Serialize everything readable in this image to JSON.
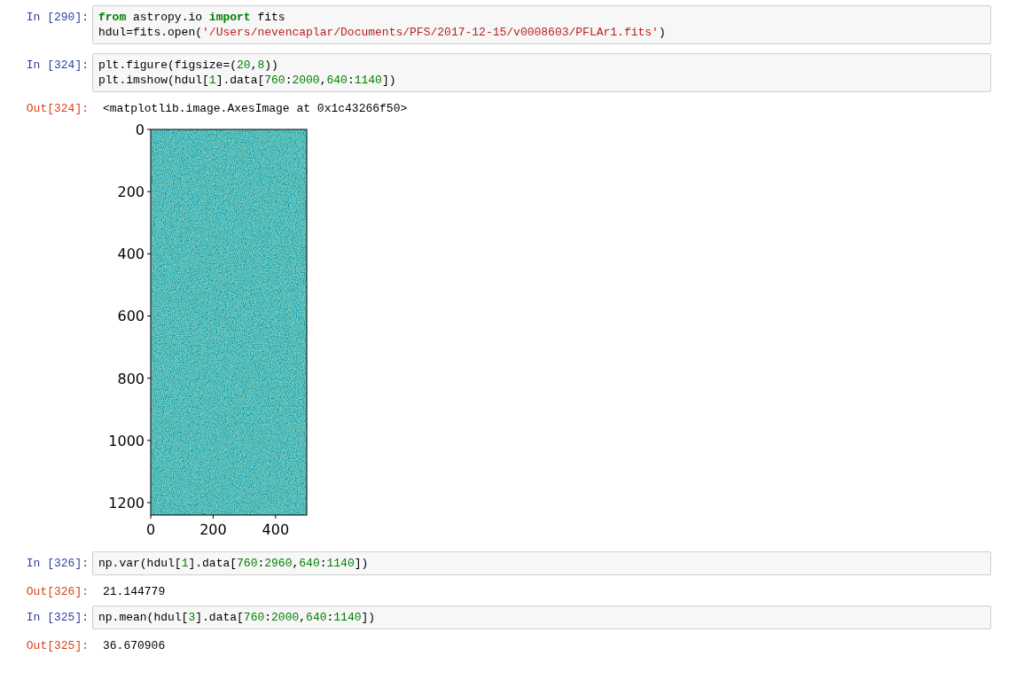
{
  "cells": [
    {
      "kind": "input",
      "prompt": "In [290]:",
      "lines": [
        [
          {
            "t": "from",
            "kind": "kw"
          },
          {
            "t": " astropy.io ",
            "kind": "plain"
          },
          {
            "t": "import",
            "kind": "kw"
          },
          {
            "t": " fits",
            "kind": "plain"
          }
        ],
        [
          {
            "t": "hdul=fits.open(",
            "kind": "plain"
          },
          {
            "t": "'/Users/nevencaplar/Documents/PFS/2017-12-15/v0008603/PFLAr1.fits'",
            "kind": "str"
          },
          {
            "t": ")",
            "kind": "plain"
          }
        ]
      ]
    },
    {
      "kind": "input",
      "prompt": "In [324]:",
      "lines": [
        [
          {
            "t": "plt.figure(figsize=(",
            "kind": "plain"
          },
          {
            "t": "20",
            "kind": "num"
          },
          {
            "t": ",",
            "kind": "plain"
          },
          {
            "t": "8",
            "kind": "num"
          },
          {
            "t": "))",
            "kind": "plain"
          }
        ],
        [
          {
            "t": "plt.imshow(hdul[",
            "kind": "plain"
          },
          {
            "t": "1",
            "kind": "num"
          },
          {
            "t": "].data[",
            "kind": "plain"
          },
          {
            "t": "760",
            "kind": "num"
          },
          {
            "t": ":",
            "kind": "plain"
          },
          {
            "t": "2000",
            "kind": "num"
          },
          {
            "t": ",",
            "kind": "plain"
          },
          {
            "t": "640",
            "kind": "num"
          },
          {
            "t": ":",
            "kind": "plain"
          },
          {
            "t": "1140",
            "kind": "num"
          },
          {
            "t": "])",
            "kind": "plain"
          }
        ]
      ]
    },
    {
      "kind": "output",
      "prompt": "Out[324]:",
      "text": "<matplotlib.image.AxesImage at 0x1c43266f50>"
    },
    {
      "kind": "image",
      "yticks": [
        "0",
        "200",
        "400",
        "600",
        "800",
        "1000",
        "1200"
      ],
      "xticks": [
        "0",
        "200",
        "400"
      ]
    },
    {
      "kind": "input",
      "prompt": "In [326]:",
      "lines": [
        [
          {
            "t": "np.var(hdul[",
            "kind": "plain"
          },
          {
            "t": "1",
            "kind": "num"
          },
          {
            "t": "].data[",
            "kind": "plain"
          },
          {
            "t": "760",
            "kind": "num"
          },
          {
            "t": ":",
            "kind": "plain"
          },
          {
            "t": "2960",
            "kind": "num"
          },
          {
            "t": ",",
            "kind": "plain"
          },
          {
            "t": "640",
            "kind": "num"
          },
          {
            "t": ":",
            "kind": "plain"
          },
          {
            "t": "1140",
            "kind": "num"
          },
          {
            "t": "])",
            "kind": "plain"
          }
        ]
      ]
    },
    {
      "kind": "output",
      "prompt": "Out[326]:",
      "text": "21.144779"
    },
    {
      "kind": "input",
      "prompt": "In [325]:",
      "lines": [
        [
          {
            "t": "np.mean(hdul[",
            "kind": "plain"
          },
          {
            "t": "3",
            "kind": "num"
          },
          {
            "t": "].data[",
            "kind": "plain"
          },
          {
            "t": "760",
            "kind": "num"
          },
          {
            "t": ":",
            "kind": "plain"
          },
          {
            "t": "2000",
            "kind": "num"
          },
          {
            "t": ",",
            "kind": "plain"
          },
          {
            "t": "640",
            "kind": "num"
          },
          {
            "t": ":",
            "kind": "plain"
          },
          {
            "t": "1140",
            "kind": "num"
          },
          {
            "t": "])",
            "kind": "plain"
          }
        ]
      ]
    },
    {
      "kind": "output",
      "prompt": "Out[325]:",
      "text": "36.670906"
    }
  ]
}
